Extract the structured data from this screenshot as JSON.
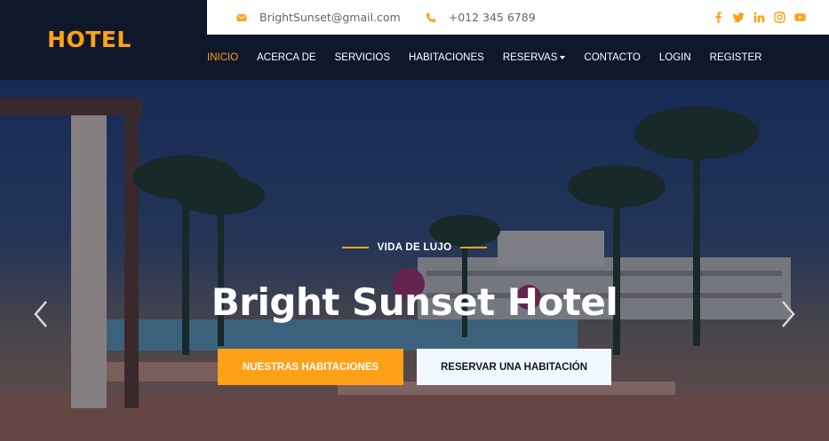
{
  "brand": {
    "name": "HOTEL"
  },
  "contact": {
    "email": "BrightSunset@gmail.com",
    "phone": "+012 345 6789",
    "email_icon": "envelope-icon",
    "phone_icon": "phone-icon"
  },
  "socials": [
    {
      "name": "facebook-icon"
    },
    {
      "name": "twitter-icon"
    },
    {
      "name": "linkedin-icon"
    },
    {
      "name": "instagram-icon"
    },
    {
      "name": "youtube-icon"
    }
  ],
  "nav": {
    "items": [
      {
        "label": "INICIO",
        "active": true
      },
      {
        "label": "ACERCA DE"
      },
      {
        "label": "SERVICIOS"
      },
      {
        "label": "HABITACIONES"
      },
      {
        "label": "RESERVAS",
        "dropdown": true
      },
      {
        "label": "CONTACTO"
      },
      {
        "label": "LOGIN"
      },
      {
        "label": "REGISTER"
      }
    ]
  },
  "hero": {
    "subtitle": "VIDA DE LUJO",
    "title": "Bright Sunset Hotel",
    "primary_button": "NUESTRAS HABITACIONES",
    "secondary_button": "RESERVAR UNA HABITACIÓN",
    "prev_icon": "chevron-left-icon",
    "next_icon": "chevron-right-icon"
  },
  "colors": {
    "accent": "#fea116",
    "dark": "#0f172b",
    "light_button": "#f1f8ff"
  }
}
